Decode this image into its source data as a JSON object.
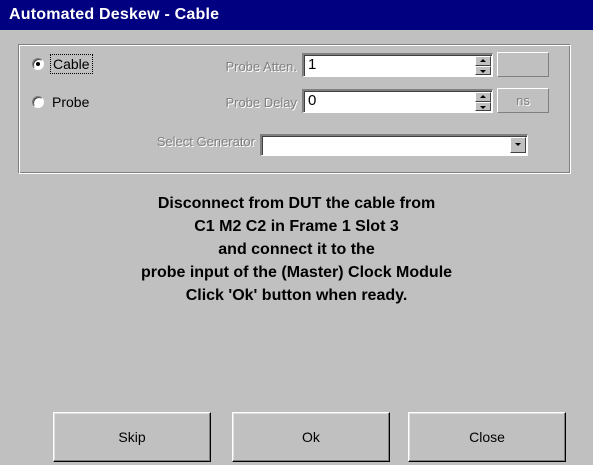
{
  "window": {
    "title": "Automated Deskew - Cable"
  },
  "mode": {
    "options": [
      {
        "label": "Cable",
        "checked": true
      },
      {
        "label": "Probe",
        "checked": false
      }
    ]
  },
  "probe_atten": {
    "label": "Probe Atten.",
    "value": "1",
    "unit": ""
  },
  "probe_delay": {
    "label": "Probe Delay",
    "value": "0",
    "unit": "ns"
  },
  "generator": {
    "label": "Select Generator",
    "value": ""
  },
  "message": {
    "lines": [
      "Disconnect from DUT the cable from",
      "C1 M2 C2 in Frame 1 Slot 3",
      "and connect it to the",
      "probe input of the (Master) Clock Module",
      "Click 'Ok' button when ready."
    ]
  },
  "buttons": {
    "skip": "Skip",
    "ok": "Ok",
    "close": "Close"
  },
  "colors": {
    "titlebar": "#000080",
    "window_face": "#c0c0c0",
    "disabled_text": "#808080"
  }
}
